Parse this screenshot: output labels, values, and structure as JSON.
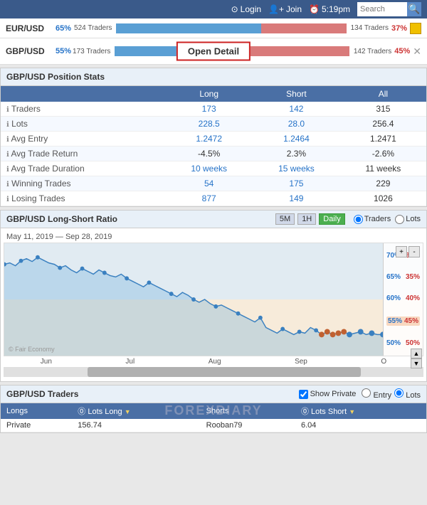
{
  "nav": {
    "login": "Login",
    "join": "Join",
    "time": "5:19pm",
    "search_placeholder": "Search",
    "search_btn": "🔍"
  },
  "eur_usd": {
    "pair": "EUR/USD",
    "long_pct": "65%",
    "long_traders": "524 Traders",
    "short_traders": "134 Traders",
    "short_pct": "37%",
    "long_bar_width": 63,
    "short_bar_width": 37
  },
  "gbp_usd": {
    "pair": "GBP/USD",
    "long_pct": "55%",
    "long_traders": "173 Traders",
    "short_traders": "142 Traders",
    "short_pct": "45%",
    "long_bar_width": 55,
    "short_bar_width": 45,
    "open_detail": "Open Detail"
  },
  "stats": {
    "title": "GBP/USD Position Stats",
    "columns": [
      "",
      "Long",
      "Short",
      "All"
    ],
    "rows": [
      {
        "label": "Traders",
        "long": "173",
        "short": "142",
        "all": "315",
        "long_colored": true
      },
      {
        "label": "Lots",
        "long": "228.5",
        "short": "28.0",
        "all": "256.4",
        "long_colored": true
      },
      {
        "label": "Avg Entry",
        "long": "1.2472",
        "short": "1.2464",
        "all": "1.2471",
        "long_colored": true
      },
      {
        "label": "Avg Trade Return",
        "long": "-4.5%",
        "short": "2.3%",
        "all": "-2.6%",
        "long_colored": false
      },
      {
        "label": "Avg Trade Duration",
        "long": "10 weeks",
        "short": "15 weeks",
        "all": "11 weeks",
        "long_colored": true
      },
      {
        "label": "Winning Trades",
        "long": "54",
        "short": "175",
        "all": "229",
        "long_colored": true
      },
      {
        "label": "Losing Trades",
        "long": "877",
        "short": "149",
        "all": "1026",
        "long_colored": true
      }
    ]
  },
  "ratio": {
    "title": "GBP/USD Long-Short Ratio",
    "tabs": [
      "5M",
      "1H",
      "Daily"
    ],
    "active_tab": "Daily",
    "date_range": "May 11, 2019 — Sep 28, 2019",
    "radio_options": [
      "Traders",
      "Lots"
    ],
    "selected_radio": "Traders",
    "labels_right": [
      {
        "long": "70%",
        "short": "30%"
      },
      {
        "long": "65%",
        "short": "35%"
      },
      {
        "long": "60%",
        "short": "40%"
      },
      {
        "long": "55%",
        "short": "45%",
        "highlight": true
      },
      {
        "long": "50%",
        "short": "50%"
      }
    ],
    "x_labels": [
      "Jun",
      "Jul",
      "Aug",
      "Sep",
      "O"
    ],
    "watermark": "© Fair Economy"
  },
  "traders": {
    "title": "GBP/USD Traders",
    "show_private": "Show Private",
    "entry_label": "Entry",
    "lots_label": "Lots",
    "columns_left": [
      "Longs",
      "⓪ Lots Long ▼"
    ],
    "columns_right": [
      "Shorts",
      "⓪ Lots Short ▼"
    ],
    "rows": [
      {
        "left_name": "Private",
        "left_lots": "156.74",
        "right_name": "Rooban79",
        "right_lots": "6.04"
      }
    ]
  }
}
